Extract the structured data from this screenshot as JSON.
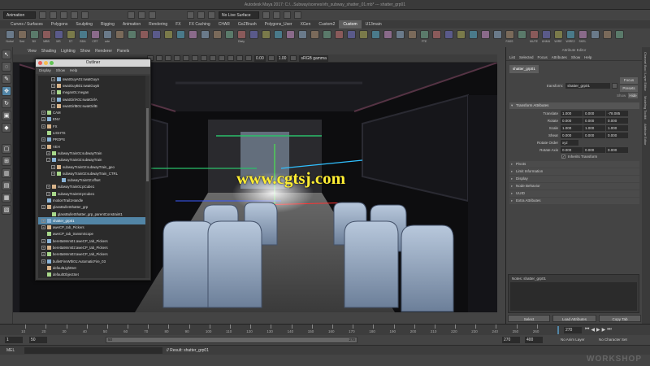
{
  "window": {
    "title": "Autodesk Maya 2017: C:/...Subway/scenes/vfx_subway_shatter_01.mb* --- shatter_grp01"
  },
  "status_line": {
    "menu_set": "Animation",
    "live_surface": "No Live Surface",
    "color_space": "sRGB gamma",
    "exposure": "0.00",
    "gamma": "1.00"
  },
  "shelf_tabs": [
    "Curves / Surfaces",
    "Polygons",
    "Sculpting",
    "Rigging",
    "Animation",
    "Rendering",
    "FX",
    "FX Caching",
    "CHAR",
    "GoZBrush",
    "Polygons_User",
    "XGen",
    "Custom2",
    "Custom",
    "U13main"
  ],
  "shelf_active": "Custom",
  "shelf_items": [
    "Nobal",
    "Sed",
    "BX",
    "MBB",
    "MS",
    "ST",
    "BDA",
    "CRT",
    "ccle",
    "",
    "",
    "",
    "",
    "",
    "",
    "",
    "",
    "",
    "",
    "Dlaty",
    "",
    "",
    "",
    "",
    "",
    "",
    "",
    "",
    "",
    "",
    "",
    "",
    "",
    "",
    "FTE",
    "",
    "",
    "",
    "",
    "",
    "",
    "FASS",
    "",
    "MUTE",
    "UNMU",
    "WIRE",
    "WIRE2",
    "SKEL",
    "",
    "",
    ""
  ],
  "viewport": {
    "menu": [
      "View",
      "Shading",
      "Lighting",
      "Show",
      "Renderer",
      "Panels"
    ],
    "exposure": "0.00",
    "gamma": "1.00",
    "color_space": "sRGB gamma",
    "watermark": "www.cgtsj.com"
  },
  "outliner": {
    "title": "Outliner",
    "menu": [
      "Display",
      "Show",
      "Help"
    ],
    "rows": [
      {
        "label": "swatGuyA01:swatGuyA",
        "indent": 2,
        "expand": "+",
        "selected": false
      },
      {
        "label": "swatGuyB01:swatGuyB",
        "indent": 2,
        "expand": "+",
        "selected": false
      },
      {
        "label": "megan01:megan",
        "indent": 2,
        "expand": "+",
        "selected": false
      },
      {
        "label": "swatGirlA01:swatGirlA",
        "indent": 2,
        "expand": "+",
        "selected": false
      },
      {
        "label": "swatGirlB01:swatGirlB",
        "indent": 2,
        "expand": "+",
        "selected": false
      },
      {
        "label": "CAM",
        "indent": 0,
        "expand": "+",
        "selected": false
      },
      {
        "label": "ENV",
        "indent": 0,
        "expand": "+",
        "selected": false
      },
      {
        "label": "FX",
        "indent": 0,
        "expand": "+",
        "selected": false
      },
      {
        "label": "LIGHTS",
        "indent": 0,
        "expand": "",
        "selected": false
      },
      {
        "label": "PROPS",
        "indent": 0,
        "expand": "+",
        "selected": false
      },
      {
        "label": "VEH",
        "indent": 0,
        "expand": "-",
        "selected": false
      },
      {
        "label": "subwayTrain01:subwayTrain",
        "indent": 1,
        "expand": "+",
        "selected": false
      },
      {
        "label": "subwayTrain02:subwayTrain",
        "indent": 1,
        "expand": "-",
        "selected": false
      },
      {
        "label": "subwayTrain02:subwayTrain_geo",
        "indent": 2,
        "expand": "+",
        "selected": false
      },
      {
        "label": "subwayTrain02:subwayTrain_CTRL",
        "indent": 2,
        "expand": "+",
        "selected": false
      },
      {
        "label": "subwayTrain02:offset",
        "indent": 3,
        "expand": "",
        "selected": false
      },
      {
        "label": "subwayTrain01:pCube1",
        "indent": 1,
        "expand": "+",
        "selected": false
      },
      {
        "label": "subwayTrain02:pCube1",
        "indent": 1,
        "expand": "+",
        "selected": false
      },
      {
        "label": "motionTrail1Handle",
        "indent": 0,
        "expand": "",
        "selected": false
      },
      {
        "label": "glassBulletShatter_grp",
        "indent": 0,
        "expand": "+",
        "selected": false
      },
      {
        "label": "glassBulletShatter_grp_parentConstraint1",
        "indent": 1,
        "expand": "",
        "selected": false
      },
      {
        "label": "shatter_grp01",
        "indent": 0,
        "expand": "+",
        "selected": true
      },
      {
        "label": "aweCP_tab_Pickers",
        "indent": 0,
        "expand": "+",
        "selected": false
      },
      {
        "label": "aweCP_tab_transmScope",
        "indent": 0,
        "expand": "",
        "selected": false
      },
      {
        "label": "beretta9mm01:aweCP_tab_Pickers",
        "indent": 0,
        "expand": "+",
        "selected": false
      },
      {
        "label": "beretta9mm02:aweCP_tab_Pickers",
        "indent": 0,
        "expand": "+",
        "selected": false
      },
      {
        "label": "beretta9mm03:aweCP_tab_Pickers",
        "indent": 0,
        "expand": "+",
        "selected": false
      },
      {
        "label": "bulletFireWth01:AutomaticFire_03",
        "indent": 0,
        "expand": "+",
        "selected": false
      },
      {
        "label": "defaultLightSet",
        "indent": 0,
        "expand": "",
        "selected": false
      },
      {
        "label": "defaultObjectSet",
        "indent": 0,
        "expand": "",
        "selected": false
      },
      {
        "label": "megan01:Rmd_Joint_SelectSet",
        "indent": 0,
        "expand": "+",
        "selected": false
      }
    ]
  },
  "attribute_editor": {
    "title": "Attribute Editor",
    "menu": [
      "List",
      "Selected",
      "Focus",
      "Attributes",
      "Show",
      "Help"
    ],
    "node_tab": "shatter_grp01",
    "transform_label": "transform:",
    "transform_value": "shatter_grp01",
    "focus_btn": "Focus",
    "presets_btn": "Presets",
    "show_label": "Show",
    "hide_btn": "Hide",
    "section_open": "Transform Attributes",
    "translate_label": "Translate",
    "translate": [
      "1.000",
      "0.000",
      "-78.085"
    ],
    "rotate_label": "Rotate",
    "rotate": [
      "0.000",
      "0.000",
      "0.000"
    ],
    "scale_label": "Scale",
    "scale": [
      "1.000",
      "1.000",
      "1.000"
    ],
    "shear_label": "Shear",
    "shear": [
      "0.000",
      "0.000",
      "0.000"
    ],
    "rotate_order_label": "Rotate Order",
    "rotate_order": "xyz",
    "rotate_axis_label": "Rotate Axis",
    "rotate_axis": [
      "0.000",
      "0.000",
      "0.000"
    ],
    "inherits_label": "Inherits Transform",
    "sections": [
      "Pivots",
      "Limit Information",
      "Display",
      "Node Behavior",
      "UUID",
      "Extra Attributes"
    ],
    "notes_label": "Notes: shatter_grp01",
    "buttons": [
      "Select",
      "Load Attributes",
      "Copy Tab"
    ]
  },
  "side_tabs": [
    "Channel Box / Layer Editor",
    "Modeling Toolkit",
    "Attribute Editor"
  ],
  "timeline": {
    "ticks": [
      "10",
      "20",
      "30",
      "40",
      "50",
      "60",
      "70",
      "80",
      "90",
      "100",
      "110",
      "120",
      "130",
      "140",
      "150",
      "160",
      "170",
      "180",
      "190",
      "200",
      "210",
      "220",
      "230",
      "240",
      "250",
      "260"
    ],
    "current_frame": "270"
  },
  "range": {
    "start": "1",
    "start_inner": "50",
    "end_inner": "270",
    "slider_start": "50",
    "slider_end": "270",
    "end": "400",
    "anim_layer": "No Anim Layer",
    "char_set": "No Character Set"
  },
  "command": {
    "lang": "MEL",
    "result": "// Result: shatter_grp01"
  },
  "brand": "WORKSHOP"
}
